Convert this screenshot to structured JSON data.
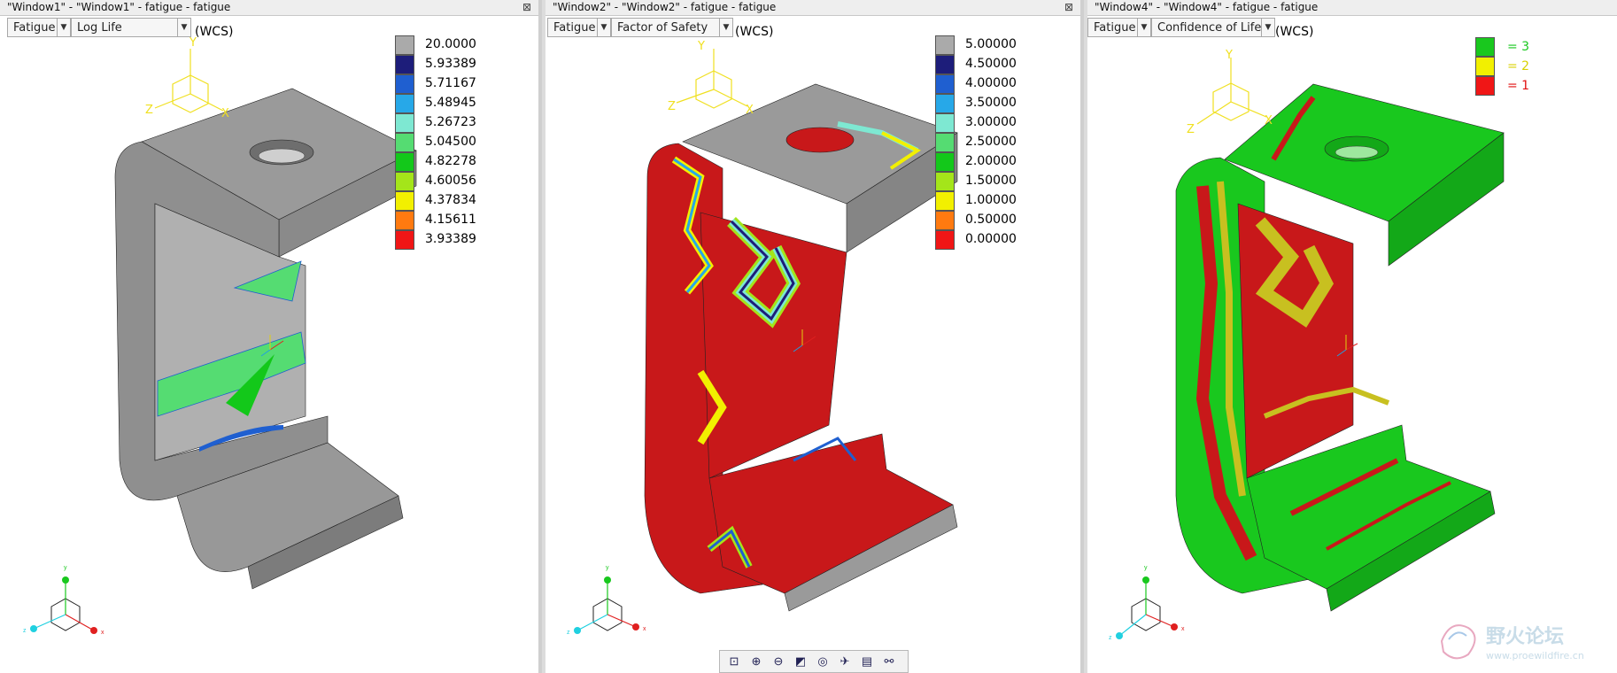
{
  "windows": [
    {
      "title": "\"Window1\" - \"Window1\" - fatigue - fatigue",
      "close_glyph": "⊠",
      "dropdown1": "Fatigue",
      "dropdown2": "Log Life",
      "wcs": "(WCS)",
      "legend": [
        {
          "value": "20.0000",
          "color": "#aaaaaa"
        },
        {
          "value": "5.93389",
          "color": "#1d1d7a"
        },
        {
          "value": "5.71167",
          "color": "#1f5fd0"
        },
        {
          "value": "5.48945",
          "color": "#27a8e8"
        },
        {
          "value": "5.26723",
          "color": "#7ee8d2"
        },
        {
          "value": "5.04500",
          "color": "#55dc72"
        },
        {
          "value": "4.82278",
          "color": "#13c81a"
        },
        {
          "value": "4.60056",
          "color": "#a4e51a"
        },
        {
          "value": "4.37834",
          "color": "#f2f000"
        },
        {
          "value": "4.15611",
          "color": "#ff7a10"
        },
        {
          "value": "3.93389",
          "color": "#f01616"
        }
      ]
    },
    {
      "title": "\"Window2\" - \"Window2\" - fatigue - fatigue",
      "close_glyph": "⊠",
      "dropdown1": "Fatigue",
      "dropdown2": "Factor of Safety",
      "wcs": "(WCS)",
      "legend": [
        {
          "value": "5.00000",
          "color": "#aaaaaa"
        },
        {
          "value": "4.50000",
          "color": "#1d1d7a"
        },
        {
          "value": "4.00000",
          "color": "#1f5fd0"
        },
        {
          "value": "3.50000",
          "color": "#27a8e8"
        },
        {
          "value": "3.00000",
          "color": "#7ee8d2"
        },
        {
          "value": "2.50000",
          "color": "#55dc72"
        },
        {
          "value": "2.00000",
          "color": "#13c81a"
        },
        {
          "value": "1.50000",
          "color": "#a4e51a"
        },
        {
          "value": "1.00000",
          "color": "#f2f000"
        },
        {
          "value": "0.50000",
          "color": "#ff7a10"
        },
        {
          "value": "0.00000",
          "color": "#f01616"
        }
      ]
    },
    {
      "title": "\"Window4\" - \"Window4\" - fatigue - fatigue",
      "dropdown1": "Fatigue",
      "dropdown2": "Confidence of Life",
      "wcs": "(WCS)",
      "legend": [
        {
          "value": "= 3",
          "color": "#19c81e",
          "text_color": "#19c81e"
        },
        {
          "value": "= 2",
          "color": "#f2f000",
          "text_color": "#d8d000"
        },
        {
          "value": "= 1",
          "color": "#f01616",
          "text_color": "#e01010"
        }
      ]
    }
  ],
  "triad_labels": {
    "x": "X",
    "y": "Y",
    "z": "Z"
  },
  "small_triad_labels": {
    "x": "x",
    "y": "y",
    "z": "z"
  },
  "toolbar_icons": [
    "zoom-fit-icon",
    "zoom-in-icon",
    "zoom-out-icon",
    "zoom-window-icon",
    "orient-icon",
    "spin-icon",
    "saved-views-icon",
    "display-style-icon"
  ],
  "watermark": {
    "cn": "野火论坛",
    "url": "www.proewildfire.cn"
  },
  "colors": {
    "gray": "#9a9a9a",
    "red": "#c8181a",
    "green": "#19c81e",
    "yellow": "#c8c020",
    "triad": "#f0e020"
  }
}
